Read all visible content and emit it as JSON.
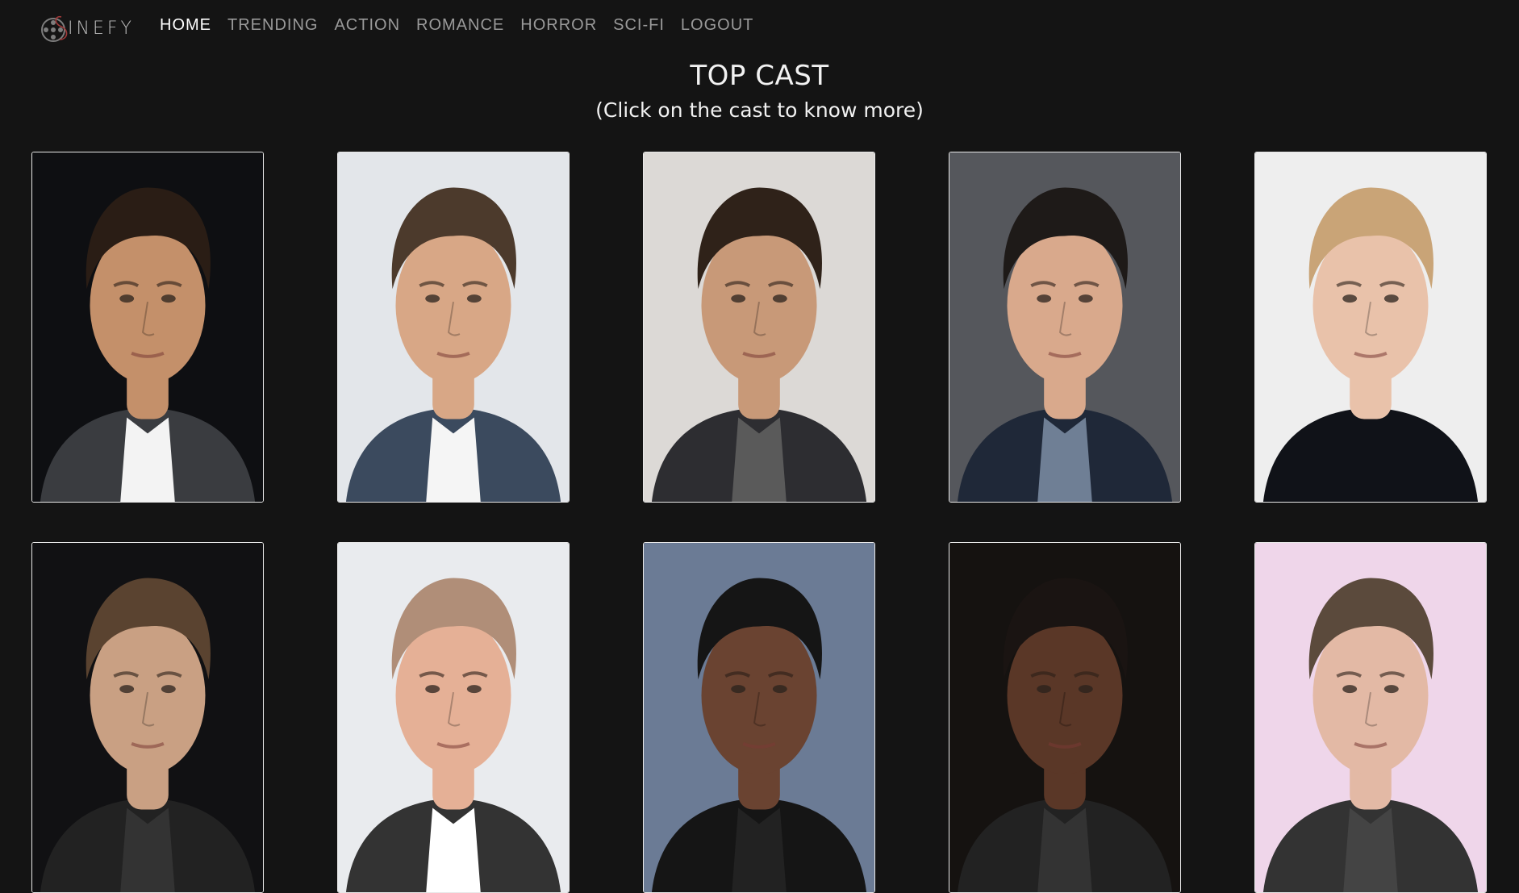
{
  "brand": {
    "logo_text": "INEFY"
  },
  "nav": {
    "items": [
      {
        "label": "HOME",
        "active": true
      },
      {
        "label": "TRENDING"
      },
      {
        "label": "ACTION"
      },
      {
        "label": "ROMANCE"
      },
      {
        "label": "HORROR"
      },
      {
        "label": "SCI-FI"
      },
      {
        "label": "LOGOUT"
      }
    ]
  },
  "main": {
    "title": "TOP CAST",
    "subtitle": "(Click on the cast to know more)"
  },
  "cast": {
    "cards": [
      {
        "bg": "#0e0f12",
        "skin": "#c4906a",
        "hair": "#2a1d15",
        "outfit": "#3a3c40",
        "shirt": "#f3f3f3"
      },
      {
        "bg": "#e3e6ea",
        "skin": "#d8a786",
        "hair": "#4c3a2c",
        "outfit": "#3b4a5e",
        "shirt": "#f5f5f5"
      },
      {
        "bg": "#dcd9d6",
        "skin": "#c89978",
        "hair": "#2f2219",
        "outfit": "#2d2d31",
        "shirt": "#5a5a5a"
      },
      {
        "bg": "#55575c",
        "skin": "#d9a98c",
        "hair": "#1e1a18",
        "outfit": "#1f2838",
        "shirt": "#6f7f95"
      },
      {
        "bg": "#eeeeee",
        "skin": "#e9c2aa",
        "hair": "#c9a477",
        "outfit": "#101218",
        "shirt": "#101218"
      },
      {
        "bg": "#111113",
        "skin": "#c9a083",
        "hair": "#5a4330",
        "outfit": "#222",
        "shirt": "#333"
      },
      {
        "bg": "#e9ebee",
        "skin": "#e5b096",
        "hair": "#b08e78",
        "outfit": "#333",
        "shirt": "#fff"
      },
      {
        "bg": "#6b7b95",
        "skin": "#6a4331",
        "hair": "#151515",
        "outfit": "#151515",
        "shirt": "#222"
      },
      {
        "bg": "#151210",
        "skin": "#5a3727",
        "hair": "#1a1412",
        "outfit": "#222",
        "shirt": "#333"
      },
      {
        "bg": "#efd6ea",
        "skin": "#e3b9a5",
        "hair": "#5b4a3c",
        "outfit": "#333",
        "shirt": "#444"
      }
    ]
  }
}
